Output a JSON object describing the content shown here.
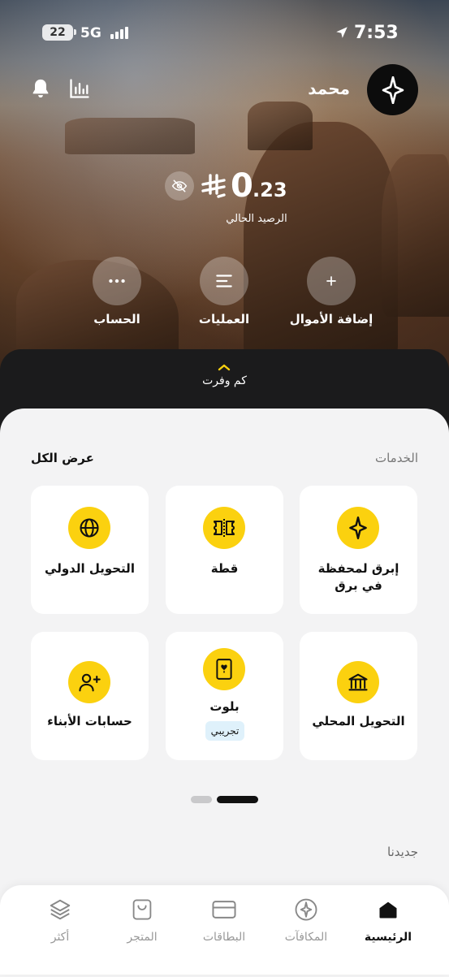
{
  "status_bar": {
    "battery": "22",
    "network": "5G",
    "time": "7:53"
  },
  "header": {
    "username": "محمد"
  },
  "balance": {
    "amount_int": "0",
    "amount_dec": ".23",
    "label": "الرصيد الحالي"
  },
  "actions": [
    {
      "label": "إضافة الأموال"
    },
    {
      "label": "العمليات"
    },
    {
      "label": "الحساب"
    }
  ],
  "savings": {
    "label": "كم وفرت"
  },
  "services": {
    "title": "الخدمات",
    "view_all": "عرض الكل",
    "items": [
      {
        "label": "إبرق لمحفظة في برق"
      },
      {
        "label": "قطة"
      },
      {
        "label": "التحويل الدولي"
      },
      {
        "label": "التحويل المحلي"
      },
      {
        "label": "بلوت",
        "badge": "تجريبي"
      },
      {
        "label": "حسابات الأبناء"
      }
    ],
    "pager": {
      "pages": 2,
      "active_page": 1
    }
  },
  "new_section": {
    "title": "جديدنا"
  },
  "tabbar": [
    {
      "label": "الرئيسية",
      "active": true
    },
    {
      "label": "المكافآت"
    },
    {
      "label": "البطاقات"
    },
    {
      "label": "المتجر"
    },
    {
      "label": "أكثر"
    }
  ],
  "colors": {
    "accent": "#fbd10f",
    "dark": "#111111",
    "badge_bg": "#dff1fb"
  }
}
